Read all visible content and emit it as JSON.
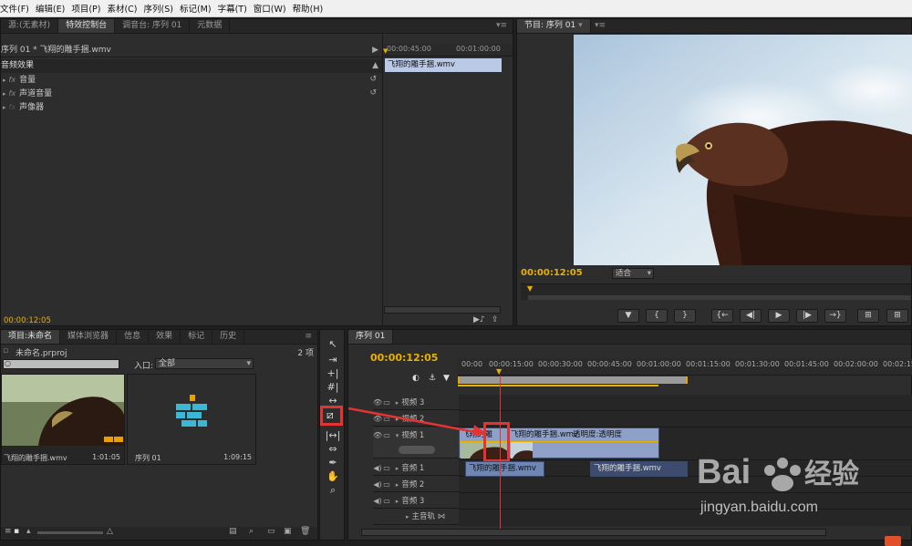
{
  "menu": [
    "文件(F)",
    "编辑(E)",
    "项目(P)",
    "素材(C)",
    "序列(S)",
    "标记(M)",
    "字幕(T)",
    "窗口(W)",
    "帮助(H)"
  ],
  "source_panel": {
    "tabs": [
      "源:(无素材)",
      "特效控制台",
      "调音台: 序列 01",
      "元数据"
    ],
    "clip_title": "序列 01 * 飞翔的雕手捆.wmv",
    "ruler": [
      "00:00:45:00",
      "00:01:00:00"
    ],
    "clip_bar_label": "飞翔的雕手捆.wmv",
    "section": "音频效果",
    "effects": [
      "音量",
      "声道音量",
      "声像器"
    ],
    "timecode": "00:00:12:05"
  },
  "program": {
    "tab": "节目: 序列 01",
    "timecode": "00:00:12:05",
    "fit": "适合",
    "transport": [
      "▼",
      "{",
      "}",
      "{←",
      "◀|",
      "▶",
      "|▶",
      "→}",
      "⊞",
      "⊞"
    ]
  },
  "project": {
    "tabs": [
      "项目:未命名",
      "媒体浏览器",
      "信息",
      "效果",
      "标记",
      "历史"
    ],
    "filename": "未命名.prproj",
    "count": "2 项",
    "in_label": "入口:",
    "in_value": "全部",
    "items": [
      {
        "name": "飞翔的雕手捆.wmv",
        "duration": "1:01:05"
      },
      {
        "name": "序列 01",
        "duration": "1:09:15"
      }
    ]
  },
  "timeline": {
    "tab": "序列 01",
    "timecode": "00:00:12:05",
    "ruler": [
      "00:00",
      "00:00:15:00",
      "00:00:30:00",
      "00:00:45:00",
      "00:01:00:00",
      "00:01:15:00",
      "00:01:30:00",
      "00:01:45:00",
      "00:02:00:00",
      "00:02:15:00"
    ],
    "tracks": [
      "视频 3",
      "视频 2",
      "视频 1",
      "音频 1",
      "音频 2",
      "音频 3",
      "主音轨"
    ],
    "video_clip_label": "飞翔的雕",
    "video_clip_label2": "飞翔的雕手捆.wmv",
    "opacity_label": "透明度:透明度",
    "audio_clip_a": "飞翔的雕手捆.wmv",
    "audio_clip_b": "飞翔的雕手捆.wmv"
  },
  "watermark": {
    "brand": "Baidu经验",
    "url": "jingyan.baidu.com"
  },
  "colors": {
    "accent": "#e9b000",
    "highlight": "#e33333",
    "clip": "#6f86b5"
  }
}
